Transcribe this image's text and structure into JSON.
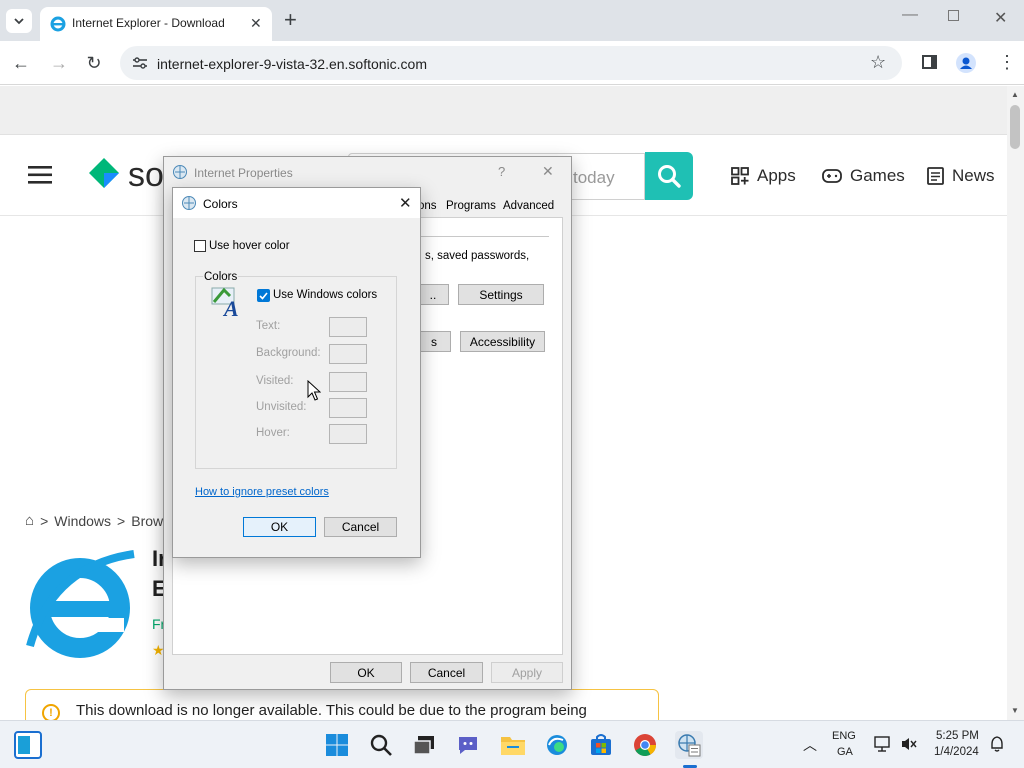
{
  "browser": {
    "tab_title": "Internet Explorer - Download",
    "new_tab": "+",
    "url": "internet-explorer-9-vista-32.en.softonic.com"
  },
  "site": {
    "logo_text": "sof",
    "search_placeholder": "today",
    "nav": {
      "apps": "Apps",
      "games": "Games",
      "news": "News"
    },
    "breadcrumb": {
      "sep1": ">",
      "windows": "Windows",
      "sep2": ">",
      "browsers": "Brow"
    },
    "title_partial_1": "Ir",
    "title_partial_2": "E",
    "free_partial": "Fr",
    "notice": "This download is no longer available. This could be due to the program being"
  },
  "internet_properties": {
    "title": "Internet Properties",
    "help": "?",
    "close": "✕",
    "tabs": {
      "connections_partial": "ons",
      "programs": "Programs",
      "advanced": "Advanced"
    },
    "text_partial": "s, saved passwords,",
    "btn_partial_1": "..",
    "settings": "Settings",
    "btn_partial_2": "s",
    "accessibility": "Accessibility",
    "ok": "OK",
    "cancel": "Cancel",
    "apply": "Apply"
  },
  "colors_dialog": {
    "title": "Colors",
    "close": "✕",
    "use_hover_color": "Use hover color",
    "group_label": "Colors",
    "use_windows_colors": "Use Windows colors",
    "text": "Text:",
    "background": "Background:",
    "visited": "Visited:",
    "unvisited": "Unvisited:",
    "hover": "Hover:",
    "link": "How to ignore preset colors",
    "ok": "OK",
    "cancel": "Cancel",
    "use_hover_checked": false,
    "use_windows_checked": true
  },
  "taskbar": {
    "lang": "ENG",
    "layout": "GA",
    "time": "5:25 PM",
    "date": "1/4/2024"
  },
  "colors": {
    "accent": "#0078d7",
    "softonic_green": "#00b779",
    "search_teal": "#1fc0b4",
    "notice_border": "#f6c343",
    "ie_blue": "#1ba1e2"
  }
}
